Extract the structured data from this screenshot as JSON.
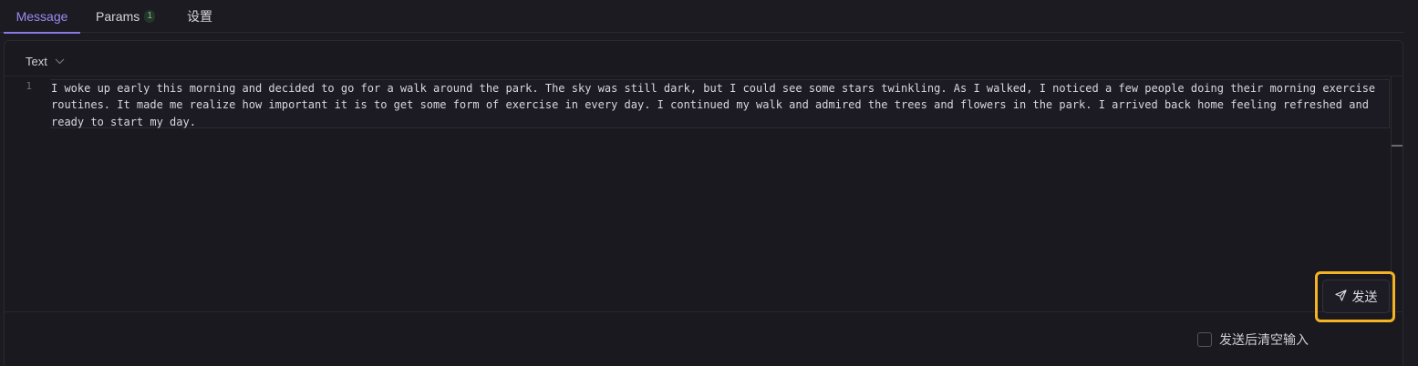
{
  "tabs": [
    {
      "label": "Message",
      "active": true
    },
    {
      "label": "Params",
      "badge": "1"
    },
    {
      "label": "设置"
    }
  ],
  "editor": {
    "type_label": "Text",
    "line_number": "1",
    "content": "I woke up early this morning and decided to go for a walk around the park. The sky was still dark, but I could see some stars twinkling. As I walked, I noticed a few people doing their morning exercise routines. It made me realize how important it is to get some form of exercise in every day. I continued my walk and admired the trees and flowers in the park. I arrived back home feeling refreshed and ready to start my day."
  },
  "footer": {
    "clear_after_send_label": "发送后清空输入",
    "clear_after_send_checked": false,
    "send_label": "发送"
  },
  "colors": {
    "accent": "#8a7ae6",
    "highlight": "#f4b322",
    "background": "#1c1b22"
  },
  "icons": {
    "type_dropdown": "chevron-down-icon",
    "send": "paper-plane-icon"
  }
}
